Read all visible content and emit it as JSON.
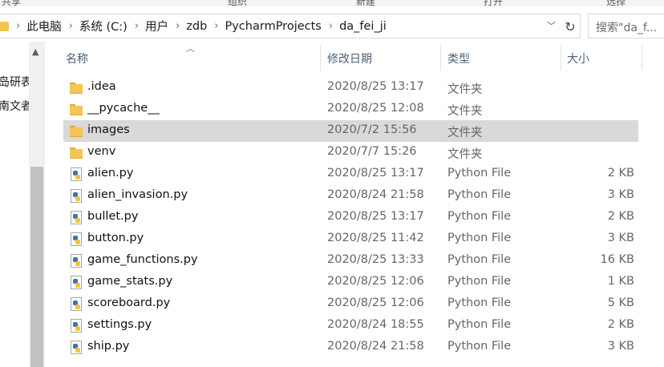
{
  "ribbon": {
    "labels": [
      "共享",
      "组织",
      "新建",
      "打开",
      "选择"
    ]
  },
  "address": {
    "crumbs": [
      "此电脑",
      "系统 (C:)",
      "用户",
      "zdb",
      "PycharmProjects",
      "da_fei_ji"
    ],
    "search_placeholder": "搜索\"da_f..."
  },
  "nav": {
    "items": [
      "岛研表",
      "南文者"
    ]
  },
  "columns": {
    "name": "名称",
    "date": "修改日期",
    "type": "类型",
    "size": "大小"
  },
  "files": [
    {
      "name": ".idea",
      "date": "2020/8/25 13:17",
      "type": "文件夹",
      "size": "",
      "kind": "folder"
    },
    {
      "name": "__pycache__",
      "date": "2020/8/25 12:08",
      "type": "文件夹",
      "size": "",
      "kind": "folder"
    },
    {
      "name": "images",
      "date": "2020/7/2 15:56",
      "type": "文件夹",
      "size": "",
      "kind": "folder",
      "selected": true
    },
    {
      "name": "venv",
      "date": "2020/7/7 15:26",
      "type": "文件夹",
      "size": "",
      "kind": "folder"
    },
    {
      "name": "alien.py",
      "date": "2020/8/25 13:17",
      "type": "Python File",
      "size": "2 KB",
      "kind": "python"
    },
    {
      "name": "alien_invasion.py",
      "date": "2020/8/24 21:58",
      "type": "Python File",
      "size": "3 KB",
      "kind": "python"
    },
    {
      "name": "bullet.py",
      "date": "2020/8/25 13:17",
      "type": "Python File",
      "size": "2 KB",
      "kind": "python"
    },
    {
      "name": "button.py",
      "date": "2020/8/25 11:42",
      "type": "Python File",
      "size": "3 KB",
      "kind": "python"
    },
    {
      "name": "game_functions.py",
      "date": "2020/8/25 13:33",
      "type": "Python File",
      "size": "16 KB",
      "kind": "python"
    },
    {
      "name": "game_stats.py",
      "date": "2020/8/25 12:06",
      "type": "Python File",
      "size": "1 KB",
      "kind": "python"
    },
    {
      "name": "scoreboard.py",
      "date": "2020/8/25 12:06",
      "type": "Python File",
      "size": "5 KB",
      "kind": "python"
    },
    {
      "name": "settings.py",
      "date": "2020/8/24 18:55",
      "type": "Python File",
      "size": "2 KB",
      "kind": "python"
    },
    {
      "name": "ship.py",
      "date": "2020/8/24 21:58",
      "type": "Python File",
      "size": "3 KB",
      "kind": "python"
    }
  ],
  "colors": {
    "selected_row": "#d9d9d9",
    "header_text": "#4c607a",
    "folder": "#f4c653"
  }
}
